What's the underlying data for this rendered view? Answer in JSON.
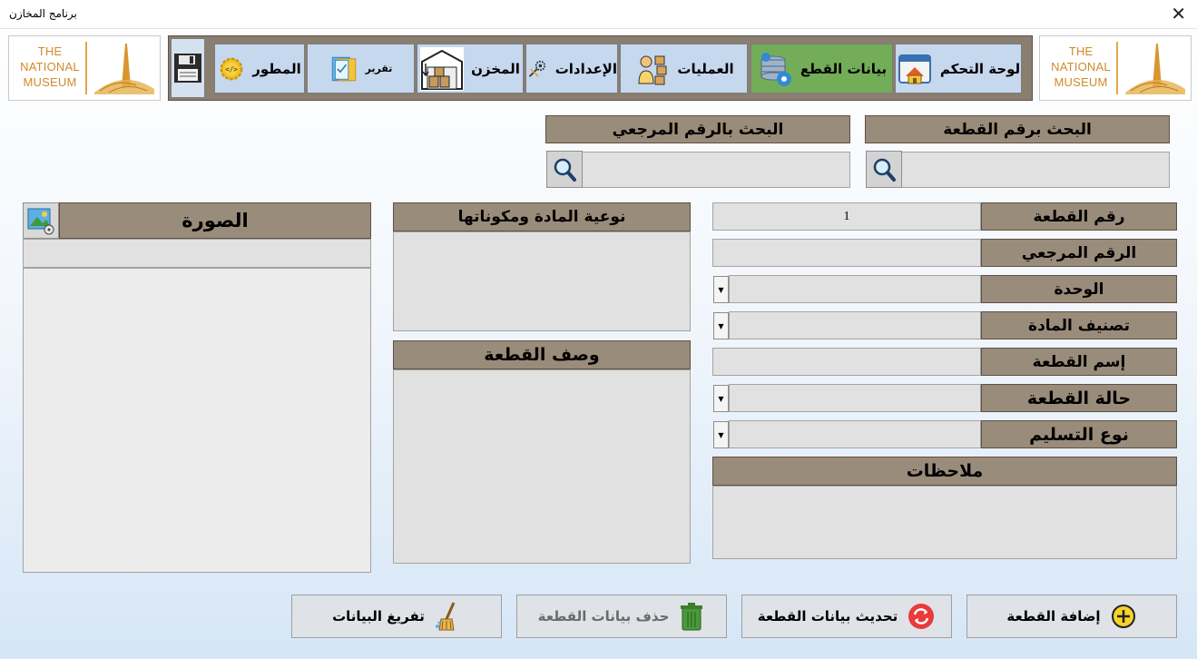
{
  "window": {
    "title": "برنامج المخازن"
  },
  "logo": {
    "lines": [
      "THE",
      "NATIONAL",
      "MUSEUM"
    ]
  },
  "nav": {
    "items": [
      {
        "label": "لوحة التحكم",
        "icon": "home-window-icon"
      },
      {
        "label": "بيانات القطع",
        "icon": "database-gear-icon"
      },
      {
        "label": "العمليات",
        "icon": "worker-boxes-icon"
      },
      {
        "label": "الإعدادات",
        "icon": "tools-gear-icon"
      },
      {
        "label": "المخزن",
        "icon": "warehouse-icon"
      },
      {
        "label": "تقرير",
        "icon": "report-icon"
      },
      {
        "label": "المطور",
        "icon": "code-gear-icon"
      }
    ]
  },
  "search": {
    "by_piece_label": "البحث برقم القطعة",
    "by_ref_label": "البحث بالرقم المرجعي",
    "by_piece_value": "",
    "by_ref_value": ""
  },
  "form": {
    "piece_no_label": "رقم القطعة",
    "piece_no_value": "1",
    "ref_no_label": "الرقم المرجعي",
    "ref_no_value": "",
    "unit_label": "الوحدة",
    "unit_value": "",
    "material_class_label": "تصنيف المادة",
    "material_class_value": "",
    "piece_name_label": "إسم القطعة",
    "piece_name_value": "",
    "piece_state_label": "حالة القطعة",
    "piece_state_value": "",
    "delivery_type_label": "نوع التسليم",
    "delivery_type_value": "",
    "notes_label": "ملاحظات",
    "notes_value": "",
    "material_label": "نوعية المادة ومكوناتها",
    "material_value": "",
    "description_label": "وصف القطعة",
    "description_value": "",
    "image_label": "الصورة",
    "image_path_value": ""
  },
  "actions": {
    "add": "إضافة القطعة",
    "update": "تحديث بيانات القطعة",
    "delete": "حذف بيانات القطعة",
    "clear": "تفريغ البيانات"
  },
  "colors": {
    "label_bg": "#9a8c7a",
    "nav_active": "#73ad58",
    "nav_item": "#c6d8ee",
    "field_bg": "#e1e1e1"
  }
}
